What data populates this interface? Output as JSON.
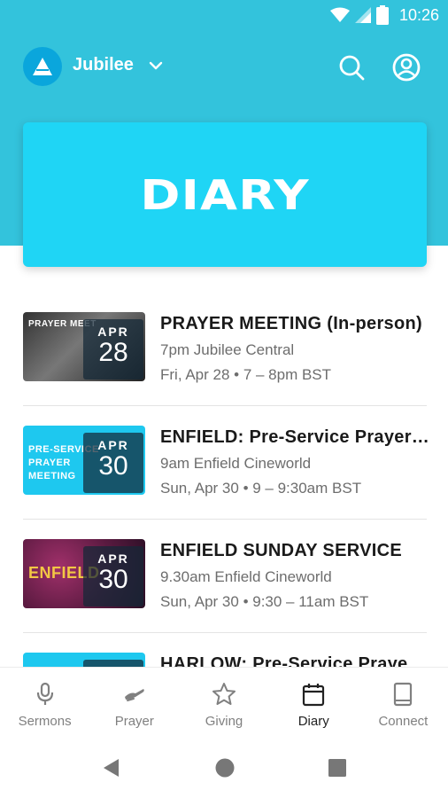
{
  "status_bar": {
    "time": "10:26"
  },
  "header": {
    "app_name": "Jubilee"
  },
  "banner": {
    "title": "DIARY"
  },
  "events": [
    {
      "thumb_text": "PRAYER MEET",
      "month": "APR",
      "day": "28",
      "title": "PRAYER MEETING (In-person)",
      "location": "7pm Jubilee Central",
      "time": "Fri, Apr 28 • 7 – 8pm BST"
    },
    {
      "thumb_text": "PRE-SERVICE PRAYER MEETING",
      "month": "APR",
      "day": "30",
      "title": "ENFIELD: Pre-Service Prayer Meeting",
      "location": "9am Enfield Cineworld",
      "time": "Sun, Apr 30 • 9 – 9:30am BST"
    },
    {
      "thumb_text": "ENFIELD",
      "month": "APR",
      "day": "30",
      "title": "ENFIELD SUNDAY SERVICE",
      "location": "9.30am Enfield Cineworld",
      "time": "Sun, Apr 30 • 9:30 – 11am BST"
    },
    {
      "thumb_text": "",
      "month": "",
      "day": "",
      "title": "HARLOW: Pre-Service Prayer Meeting",
      "location": "",
      "time": ""
    }
  ],
  "bottom_nav": [
    {
      "label": "Sermons",
      "icon": "microphone-icon",
      "active": false
    },
    {
      "label": "Prayer",
      "icon": "praying-hands-icon",
      "active": false
    },
    {
      "label": "Giving",
      "icon": "star-icon",
      "active": false
    },
    {
      "label": "Diary",
      "icon": "calendar-icon",
      "active": true
    },
    {
      "label": "Connect",
      "icon": "book-icon",
      "active": false
    }
  ],
  "colors": {
    "header_bg": "#33c3dc",
    "banner_bg": "#1fd5f5",
    "inactive_nav": "#808080",
    "active_nav": "#222222"
  }
}
